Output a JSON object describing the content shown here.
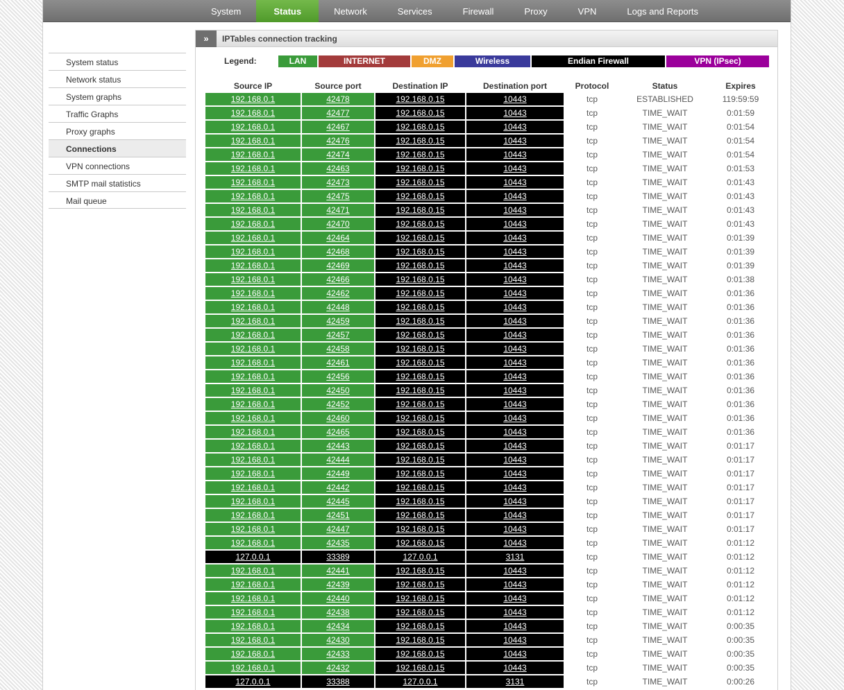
{
  "nav": {
    "tabs": [
      {
        "label": "System"
      },
      {
        "label": "Status",
        "active": true
      },
      {
        "label": "Network"
      },
      {
        "label": "Services"
      },
      {
        "label": "Firewall"
      },
      {
        "label": "Proxy"
      },
      {
        "label": "VPN"
      },
      {
        "label": "Logs and Reports"
      }
    ]
  },
  "sidebar": {
    "items": [
      {
        "label": "System status"
      },
      {
        "label": "Network status"
      },
      {
        "label": "System graphs"
      },
      {
        "label": "Traffic Graphs"
      },
      {
        "label": "Proxy graphs"
      },
      {
        "label": "Connections",
        "active": true
      },
      {
        "label": "VPN connections"
      },
      {
        "label": "SMTP mail statistics"
      },
      {
        "label": "Mail queue"
      }
    ]
  },
  "panel": {
    "title": "IPTables connection tracking",
    "chevron_icon": "double-chevron-right-icon"
  },
  "legend": {
    "label": "Legend:",
    "items": [
      {
        "label": "LAN",
        "color": "#3a9b3a"
      },
      {
        "label": "INTERNET",
        "color": "#a33b3b"
      },
      {
        "label": "DMZ",
        "color": "#f0a030"
      },
      {
        "label": "Wireless",
        "color": "#3a3a9b"
      },
      {
        "label": "Endian Firewall",
        "color": "#000000"
      },
      {
        "label": "VPN (IPsec)",
        "color": "#9b009b"
      }
    ]
  },
  "table": {
    "headers": [
      "Source IP",
      "Source port",
      "Destination IP",
      "Destination port",
      "Protocol",
      "Status",
      "Expires"
    ],
    "rows": [
      [
        "192.168.0.1",
        "42478",
        "192.168.0.15",
        "10443",
        "tcp",
        "ESTABLISHED",
        "119:59:59"
      ],
      [
        "192.168.0.1",
        "42477",
        "192.168.0.15",
        "10443",
        "tcp",
        "TIME_WAIT",
        "0:01:59"
      ],
      [
        "192.168.0.1",
        "42467",
        "192.168.0.15",
        "10443",
        "tcp",
        "TIME_WAIT",
        "0:01:54"
      ],
      [
        "192.168.0.1",
        "42476",
        "192.168.0.15",
        "10443",
        "tcp",
        "TIME_WAIT",
        "0:01:54"
      ],
      [
        "192.168.0.1",
        "42474",
        "192.168.0.15",
        "10443",
        "tcp",
        "TIME_WAIT",
        "0:01:54"
      ],
      [
        "192.168.0.1",
        "42463",
        "192.168.0.15",
        "10443",
        "tcp",
        "TIME_WAIT",
        "0:01:53"
      ],
      [
        "192.168.0.1",
        "42473",
        "192.168.0.15",
        "10443",
        "tcp",
        "TIME_WAIT",
        "0:01:43"
      ],
      [
        "192.168.0.1",
        "42475",
        "192.168.0.15",
        "10443",
        "tcp",
        "TIME_WAIT",
        "0:01:43"
      ],
      [
        "192.168.0.1",
        "42471",
        "192.168.0.15",
        "10443",
        "tcp",
        "TIME_WAIT",
        "0:01:43"
      ],
      [
        "192.168.0.1",
        "42470",
        "192.168.0.15",
        "10443",
        "tcp",
        "TIME_WAIT",
        "0:01:43"
      ],
      [
        "192.168.0.1",
        "42464",
        "192.168.0.15",
        "10443",
        "tcp",
        "TIME_WAIT",
        "0:01:39"
      ],
      [
        "192.168.0.1",
        "42468",
        "192.168.0.15",
        "10443",
        "tcp",
        "TIME_WAIT",
        "0:01:39"
      ],
      [
        "192.168.0.1",
        "42469",
        "192.168.0.15",
        "10443",
        "tcp",
        "TIME_WAIT",
        "0:01:39"
      ],
      [
        "192.168.0.1",
        "42466",
        "192.168.0.15",
        "10443",
        "tcp",
        "TIME_WAIT",
        "0:01:38"
      ],
      [
        "192.168.0.1",
        "42462",
        "192.168.0.15",
        "10443",
        "tcp",
        "TIME_WAIT",
        "0:01:36"
      ],
      [
        "192.168.0.1",
        "42448",
        "192.168.0.15",
        "10443",
        "tcp",
        "TIME_WAIT",
        "0:01:36"
      ],
      [
        "192.168.0.1",
        "42459",
        "192.168.0.15",
        "10443",
        "tcp",
        "TIME_WAIT",
        "0:01:36"
      ],
      [
        "192.168.0.1",
        "42457",
        "192.168.0.15",
        "10443",
        "tcp",
        "TIME_WAIT",
        "0:01:36"
      ],
      [
        "192.168.0.1",
        "42458",
        "192.168.0.15",
        "10443",
        "tcp",
        "TIME_WAIT",
        "0:01:36"
      ],
      [
        "192.168.0.1",
        "42461",
        "192.168.0.15",
        "10443",
        "tcp",
        "TIME_WAIT",
        "0:01:36"
      ],
      [
        "192.168.0.1",
        "42456",
        "192.168.0.15",
        "10443",
        "tcp",
        "TIME_WAIT",
        "0:01:36"
      ],
      [
        "192.168.0.1",
        "42450",
        "192.168.0.15",
        "10443",
        "tcp",
        "TIME_WAIT",
        "0:01:36"
      ],
      [
        "192.168.0.1",
        "42452",
        "192.168.0.15",
        "10443",
        "tcp",
        "TIME_WAIT",
        "0:01:36"
      ],
      [
        "192.168.0.1",
        "42460",
        "192.168.0.15",
        "10443",
        "tcp",
        "TIME_WAIT",
        "0:01:36"
      ],
      [
        "192.168.0.1",
        "42465",
        "192.168.0.15",
        "10443",
        "tcp",
        "TIME_WAIT",
        "0:01:36"
      ],
      [
        "192.168.0.1",
        "42443",
        "192.168.0.15",
        "10443",
        "tcp",
        "TIME_WAIT",
        "0:01:17"
      ],
      [
        "192.168.0.1",
        "42444",
        "192.168.0.15",
        "10443",
        "tcp",
        "TIME_WAIT",
        "0:01:17"
      ],
      [
        "192.168.0.1",
        "42449",
        "192.168.0.15",
        "10443",
        "tcp",
        "TIME_WAIT",
        "0:01:17"
      ],
      [
        "192.168.0.1",
        "42442",
        "192.168.0.15",
        "10443",
        "tcp",
        "TIME_WAIT",
        "0:01:17"
      ],
      [
        "192.168.0.1",
        "42445",
        "192.168.0.15",
        "10443",
        "tcp",
        "TIME_WAIT",
        "0:01:17"
      ],
      [
        "192.168.0.1",
        "42451",
        "192.168.0.15",
        "10443",
        "tcp",
        "TIME_WAIT",
        "0:01:17"
      ],
      [
        "192.168.0.1",
        "42447",
        "192.168.0.15",
        "10443",
        "tcp",
        "TIME_WAIT",
        "0:01:17"
      ],
      [
        "192.168.0.1",
        "42435",
        "192.168.0.15",
        "10443",
        "tcp",
        "TIME_WAIT",
        "0:01:12"
      ],
      [
        "127.0.0.1",
        "33389",
        "127.0.0.1",
        "3131",
        "tcp",
        "TIME_WAIT",
        "0:01:12"
      ],
      [
        "192.168.0.1",
        "42441",
        "192.168.0.15",
        "10443",
        "tcp",
        "TIME_WAIT",
        "0:01:12"
      ],
      [
        "192.168.0.1",
        "42439",
        "192.168.0.15",
        "10443",
        "tcp",
        "TIME_WAIT",
        "0:01:12"
      ],
      [
        "192.168.0.1",
        "42440",
        "192.168.0.15",
        "10443",
        "tcp",
        "TIME_WAIT",
        "0:01:12"
      ],
      [
        "192.168.0.1",
        "42438",
        "192.168.0.15",
        "10443",
        "tcp",
        "TIME_WAIT",
        "0:01:12"
      ],
      [
        "192.168.0.1",
        "42434",
        "192.168.0.15",
        "10443",
        "tcp",
        "TIME_WAIT",
        "0:00:35"
      ],
      [
        "192.168.0.1",
        "42430",
        "192.168.0.15",
        "10443",
        "tcp",
        "TIME_WAIT",
        "0:00:35"
      ],
      [
        "192.168.0.1",
        "42433",
        "192.168.0.15",
        "10443",
        "tcp",
        "TIME_WAIT",
        "0:00:35"
      ],
      [
        "192.168.0.1",
        "42432",
        "192.168.0.15",
        "10443",
        "tcp",
        "TIME_WAIT",
        "0:00:35"
      ],
      [
        "127.0.0.1",
        "33388",
        "127.0.0.1",
        "3131",
        "tcp",
        "TIME_WAIT",
        "0:00:26"
      ]
    ]
  }
}
